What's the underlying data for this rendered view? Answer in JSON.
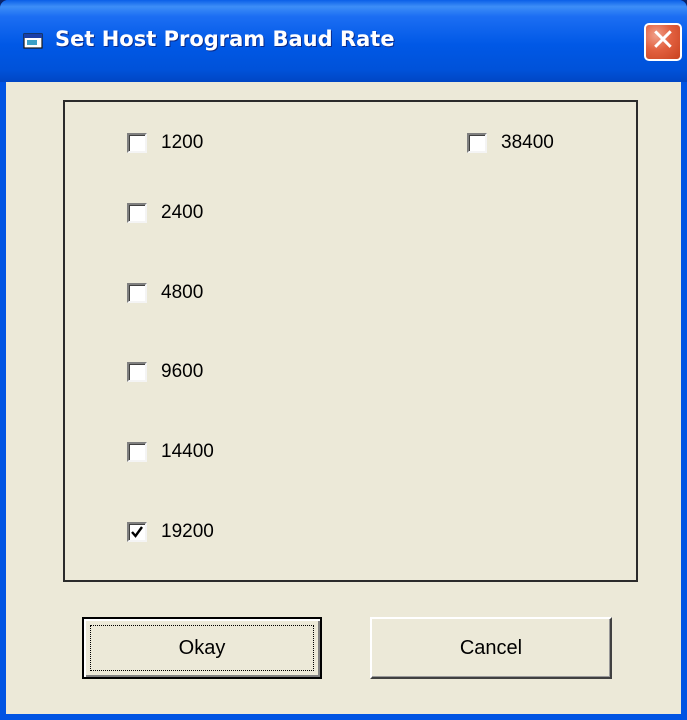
{
  "window": {
    "title": "Set Host Program Baud Rate",
    "icon": "app-window-icon",
    "close_icon": "close-icon",
    "close_glyph": "✕"
  },
  "options": [
    {
      "label": "1200",
      "checked": false
    },
    {
      "label": "2400",
      "checked": false
    },
    {
      "label": "4800",
      "checked": false
    },
    {
      "label": "9600",
      "checked": false
    },
    {
      "label": "14400",
      "checked": false
    },
    {
      "label": "19200",
      "checked": true
    },
    {
      "label": "38400",
      "checked": false
    }
  ],
  "buttons": {
    "okay": "Okay",
    "cancel": "Cancel"
  }
}
